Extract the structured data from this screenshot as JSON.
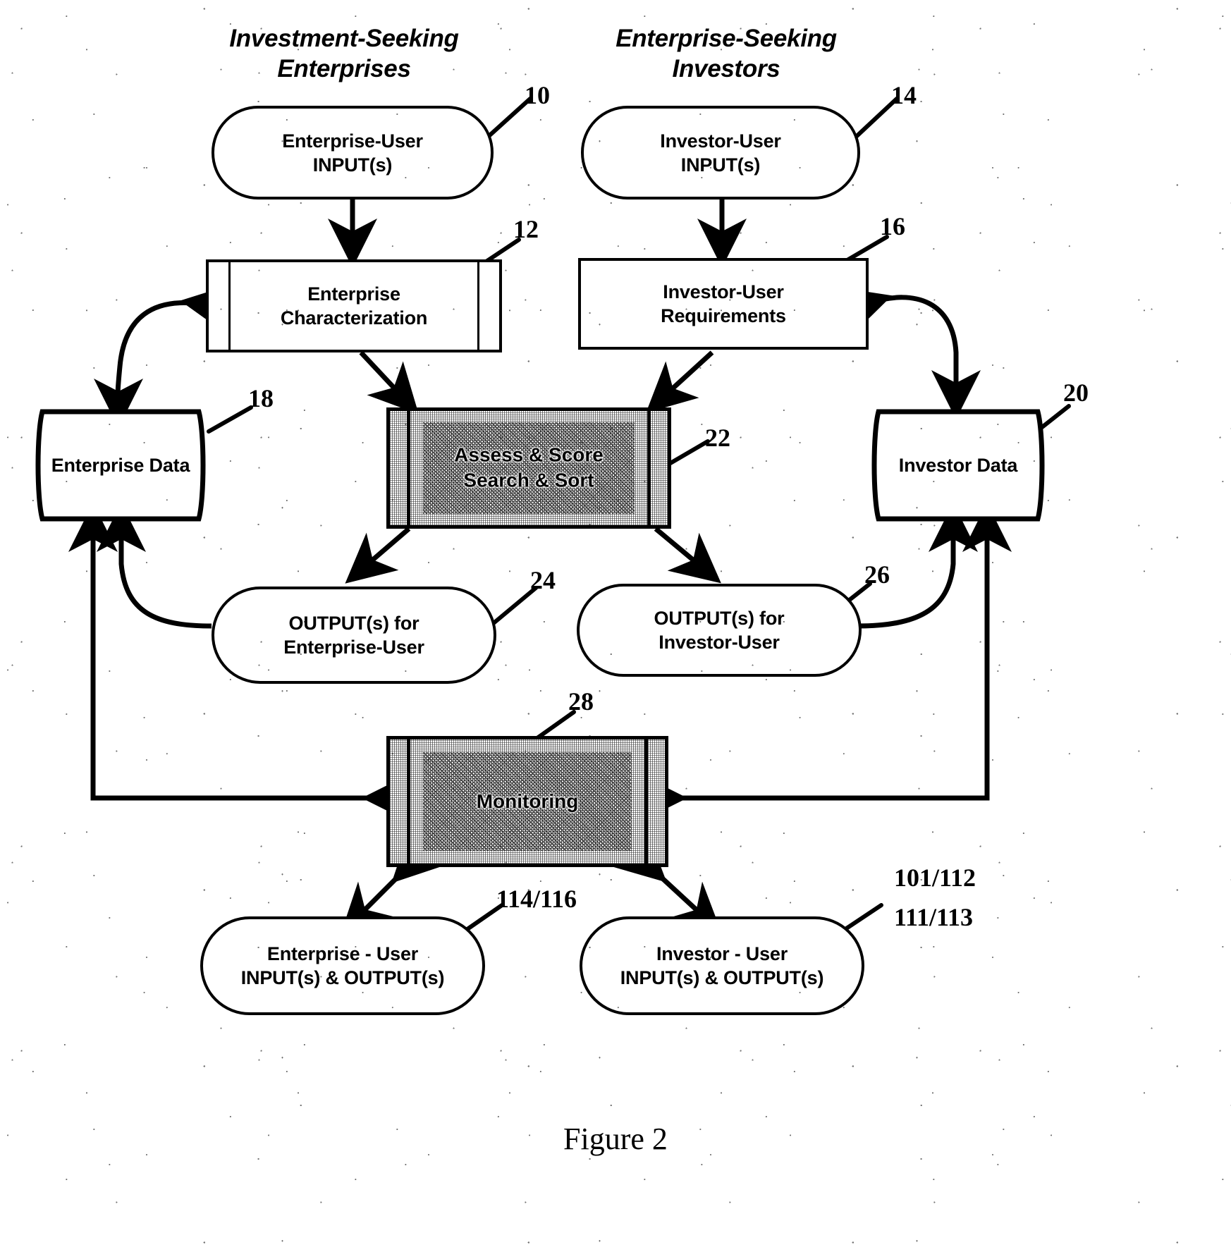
{
  "figure": {
    "caption": "Figure 2"
  },
  "headings": [
    {
      "id": "left",
      "line1": "Investment-Seeking",
      "line2": "Enterprises"
    },
    {
      "id": "right",
      "line1": "Enterprise-Seeking",
      "line2": "Investors"
    }
  ],
  "nodes": {
    "enterprise_input": {
      "line1": "Enterprise-User",
      "line2": "INPUT(s)"
    },
    "investor_input": {
      "line1": "Investor-User",
      "line2": "INPUT(s)"
    },
    "enterprise_char": {
      "line1": "Enterprise",
      "line2": "Characterization"
    },
    "investor_req": {
      "line1": "Investor-User",
      "line2": "Requirements"
    },
    "enterprise_data": {
      "line1": "Enterprise Data"
    },
    "investor_data": {
      "line1": "Investor Data"
    },
    "assess": {
      "line1": "Assess & Score",
      "line2": "Search & Sort"
    },
    "output_enterprise": {
      "line1": "OUTPUT(s) for",
      "line2": "Enterprise-User"
    },
    "output_investor": {
      "line1": "OUTPUT(s) for",
      "line2": "Investor-User"
    },
    "monitoring": {
      "line1": "Monitoring"
    },
    "enterprise_io": {
      "line1": "Enterprise - User",
      "line2": "INPUT(s) & OUTPUT(s)"
    },
    "investor_io": {
      "line1": "Investor - User",
      "line2": "INPUT(s) & OUTPUT(s)"
    }
  },
  "numerals": {
    "n10": "10",
    "n12": "12",
    "n14": "14",
    "n16": "16",
    "n18": "18",
    "n20": "20",
    "n22": "22",
    "n24": "24",
    "n26": "26",
    "n28": "28",
    "n114_116": "114/116",
    "n101_112": "101/112",
    "n111_113": "111/113"
  },
  "colors": {
    "ink": "#000000",
    "paper": "#ffffff"
  }
}
